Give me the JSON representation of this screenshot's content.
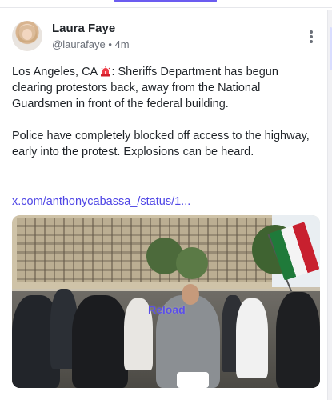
{
  "post": {
    "author_name": "Laura Faye",
    "author_handle": "@laurafaye",
    "separator": "•",
    "time_ago": "4m",
    "text_part1_location": "Los Angeles, CA ",
    "text_part1_icon": "police-siren-icon",
    "text_part1_rest": ": Sheriffs Department has begun clearing protestors back, away from the National Guardsmen in front of the federal building.",
    "text_part2": "Police have completely blocked off access to the highway, early into the protest. Explosions can be heard.",
    "link_text": "x.com/anthonycabassa_/status/1...",
    "media_reload_label": "Reload"
  },
  "colors": {
    "accent": "#6b5cf0",
    "link": "#4f46e5",
    "text": "#1f2328",
    "muted": "#6a6f78"
  },
  "icons": {
    "more": "more-vertical-icon",
    "siren": "police-siren-icon"
  }
}
